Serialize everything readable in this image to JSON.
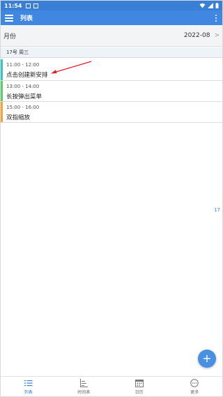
{
  "status_bar": {
    "time": "11:54"
  },
  "app_bar": {
    "title": "列表"
  },
  "month_row": {
    "label": "月份",
    "value": "2022-08"
  },
  "day_header": {
    "label": "17号 周三"
  },
  "events": [
    {
      "time": "11:00 - 12:00",
      "title": "点击创建新安排",
      "color": "#35c6bd"
    },
    {
      "time": "13:00 - 14:00",
      "title": "长按弹出菜单",
      "color": "#5dcd6b"
    },
    {
      "time": "15:00 - 16:00",
      "title": "双指缩放",
      "color": "#f0a53a"
    }
  ],
  "side_date": "17",
  "fab": {
    "icon": "plus-icon",
    "label": "+"
  },
  "bottom_nav": {
    "items": [
      {
        "label": "列表",
        "icon": "list-icon",
        "active": true
      },
      {
        "label": "时间表",
        "icon": "timeline-icon",
        "active": false
      },
      {
        "label": "日历",
        "icon": "calendar-icon",
        "active": false
      },
      {
        "label": "更多",
        "icon": "more-circle-icon",
        "active": false
      }
    ]
  },
  "colors": {
    "primary": "#3f87e0",
    "accent_arrow": "#e0202a"
  }
}
